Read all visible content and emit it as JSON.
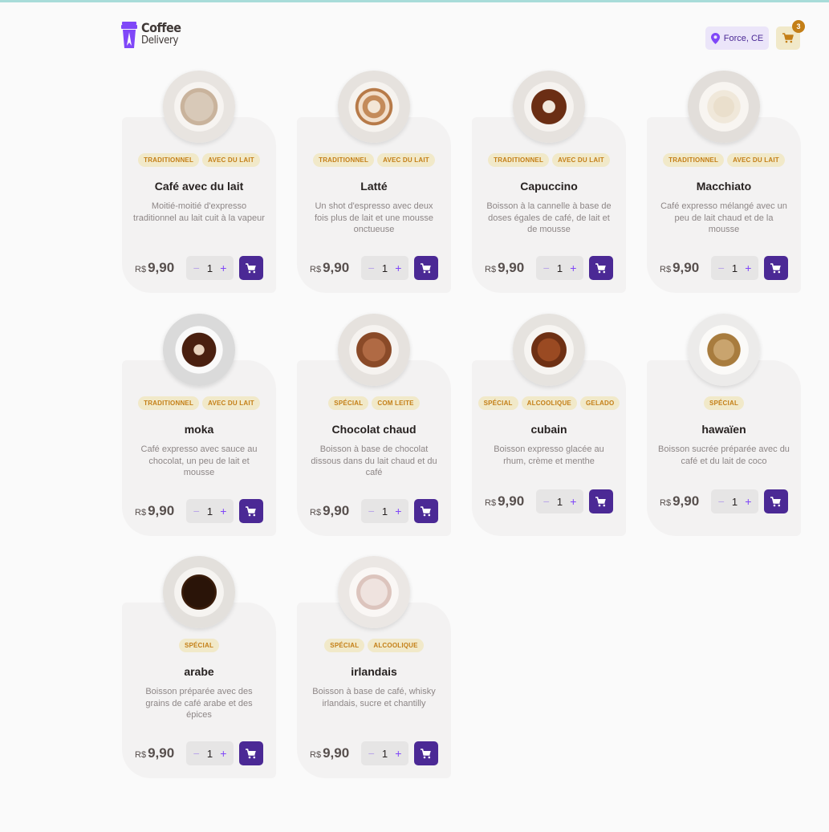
{
  "header": {
    "logo_line1": "Coffee",
    "logo_line2": "Delivery",
    "location": "Force, CE",
    "cart_count": "3"
  },
  "colors": {
    "purple": "#8047f8",
    "purple_dark": "#4b2995",
    "yellow": "#c47f17",
    "yellow_light": "#f1e9c9",
    "card_bg": "#f3f2f2"
  },
  "products": [
    {
      "name": "Café avec du lait",
      "tags": [
        "TRADITIONNEL",
        "AVEC DU LAIT"
      ],
      "desc": "Moitié-moitié d'expresso traditionnel au lait cuit à la vapeur",
      "currency": "R$",
      "price": "9,90",
      "qty": "1",
      "cup": "latte-light"
    },
    {
      "name": "Latté",
      "tags": [
        "TRADITIONNEL",
        "AVEC DU LAIT"
      ],
      "desc": "Un shot d'espresso avec deux fois plus de lait et une mousse onctueuse",
      "currency": "R$",
      "price": "9,90",
      "qty": "1",
      "cup": "latte-art"
    },
    {
      "name": "Capuccino",
      "tags": [
        "TRADITIONNEL",
        "AVEC DU LAIT"
      ],
      "desc": "Boisson à la cannelle à base de doses égales de café, de lait et de mousse",
      "currency": "R$",
      "price": "9,90",
      "qty": "1",
      "cup": "cappuccino"
    },
    {
      "name": "Macchiato",
      "tags": [
        "TRADITIONNEL",
        "AVEC DU LAIT"
      ],
      "desc": "Café expresso mélangé avec un peu de lait chaud et de la mousse",
      "currency": "R$",
      "price": "9,90",
      "qty": "1",
      "cup": "macchiato"
    },
    {
      "name": "moka",
      "tags": [
        "TRADITIONNEL",
        "AVEC DU LAIT"
      ],
      "desc": "Café expresso avec sauce au chocolat, un peu de lait et mousse",
      "currency": "R$",
      "price": "9,90",
      "qty": "1",
      "cup": "mocha"
    },
    {
      "name": "Chocolat chaud",
      "tags": [
        "SPÉCIAL",
        "COM LEITE"
      ],
      "desc": "Boisson à base de chocolat dissous dans du lait chaud et du café",
      "currency": "R$",
      "price": "9,90",
      "qty": "1",
      "cup": "chocolate"
    },
    {
      "name": "cubain",
      "tags": [
        "SPÉCIAL",
        "ALCOOLIQUE",
        "GELADO"
      ],
      "desc": "Boisson expresso glacée au rhum, crème et menthe",
      "currency": "R$",
      "price": "9,90",
      "qty": "1",
      "cup": "cuban"
    },
    {
      "name": "hawaïen",
      "tags": [
        "SPÉCIAL"
      ],
      "desc": "Boisson sucrée préparée avec du café et du lait de coco",
      "currency": "R$",
      "price": "9,90",
      "qty": "1",
      "cup": "hawaiian"
    },
    {
      "name": "arabe",
      "tags": [
        "SPÉCIAL"
      ],
      "desc": "Boisson préparée avec des grains de café arabe et des épices",
      "currency": "R$",
      "price": "9,90",
      "qty": "1",
      "cup": "arabic"
    },
    {
      "name": "irlandais",
      "tags": [
        "SPÉCIAL",
        "ALCOOLIQUE"
      ],
      "desc": "Boisson à base de café, whisky irlandais, sucre et chantilly",
      "currency": "R$",
      "price": "9,90",
      "qty": "1",
      "cup": "irish"
    }
  ]
}
